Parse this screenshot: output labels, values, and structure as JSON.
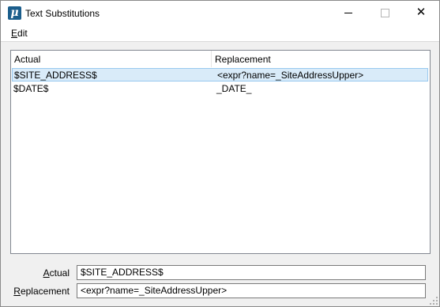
{
  "window": {
    "title": "Text Substitutions",
    "app_icon_glyph": "μ",
    "controls": {
      "minimize_icon": "minimize-icon",
      "maximize_icon": "maximize-icon",
      "close_icon": "close-icon",
      "close_glyph": "✕"
    }
  },
  "menu": {
    "edit_mnemonic": "E",
    "edit_rest": "dit"
  },
  "table": {
    "columns": [
      "Actual",
      "Replacement"
    ],
    "rows": [
      {
        "actual": "$SITE_ADDRESS$",
        "replacement": "<expr?name=_SiteAddressUpper>",
        "selected": true
      },
      {
        "actual": "$DATE$",
        "replacement": "_DATE_",
        "selected": false
      }
    ]
  },
  "fields": {
    "actual_label_mnemonic": "A",
    "actual_label_rest": "ctual",
    "actual_value": "$SITE_ADDRESS$",
    "replacement_label_mnemonic": "R",
    "replacement_label_rest": "eplacement",
    "replacement_value": "<expr?name=_SiteAddressUpper>"
  },
  "colors": {
    "selection_fill": "#d9ebf9",
    "selection_border": "#99c9ef",
    "app_icon": "#1b5e8c"
  }
}
